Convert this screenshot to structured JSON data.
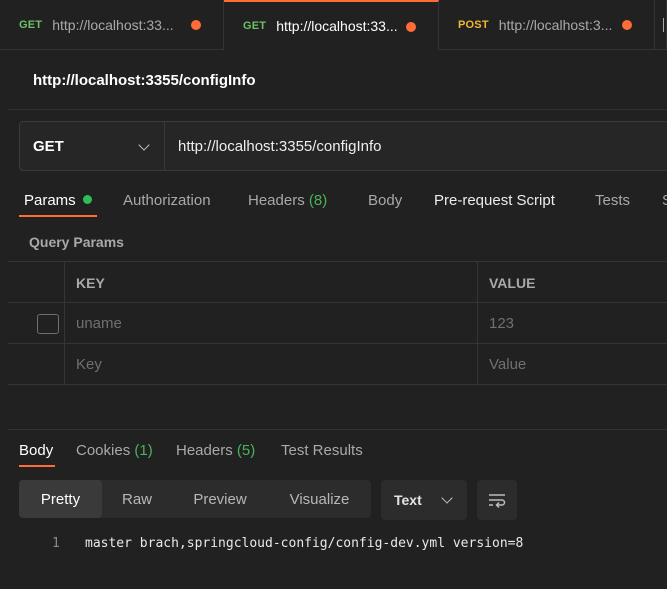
{
  "tabs": [
    {
      "method": "GET",
      "url": "http://localhost:33...",
      "unsaved": true
    },
    {
      "method": "GET",
      "url": "http://localhost:33...",
      "unsaved": true,
      "active": true
    },
    {
      "method": "POST",
      "url": "http://localhost:3...",
      "unsaved": true
    }
  ],
  "request": {
    "title": "http://localhost:3355/configInfo",
    "method": "GET",
    "url": "http://localhost:3355/configInfo"
  },
  "request_tabs": {
    "params": "Params",
    "authorization": "Authorization",
    "headers": "Headers",
    "headers_count": "(8)",
    "body": "Body",
    "pre_request": "Pre-request Script",
    "tests": "Tests",
    "settings_partial": "S"
  },
  "query_params": {
    "label": "Query Params",
    "key_header": "KEY",
    "value_header": "VALUE",
    "rows": [
      {
        "key": "uname",
        "value": "123"
      }
    ],
    "placeholder_key": "Key",
    "placeholder_value": "Value"
  },
  "response_tabs": {
    "body": "Body",
    "cookies": "Cookies",
    "cookies_count": "(1)",
    "headers": "Headers",
    "headers_count": "(5)",
    "test_results": "Test Results"
  },
  "view_modes": {
    "pretty": "Pretty",
    "raw": "Raw",
    "preview": "Preview",
    "visualize": "Visualize",
    "format": "Text"
  },
  "response_body": {
    "line_number": "1",
    "text": "master brach,springcloud-config/config-dev.yml version=8"
  },
  "colors": {
    "accent": "#ff6c37",
    "get": "#6bc06b",
    "post": "#f2b53a",
    "count_green": "#4ab35a"
  },
  "icons": [
    "chevron-down-icon",
    "wrap-lines-icon",
    "unsaved-dot-icon",
    "checkbox-icon"
  ]
}
